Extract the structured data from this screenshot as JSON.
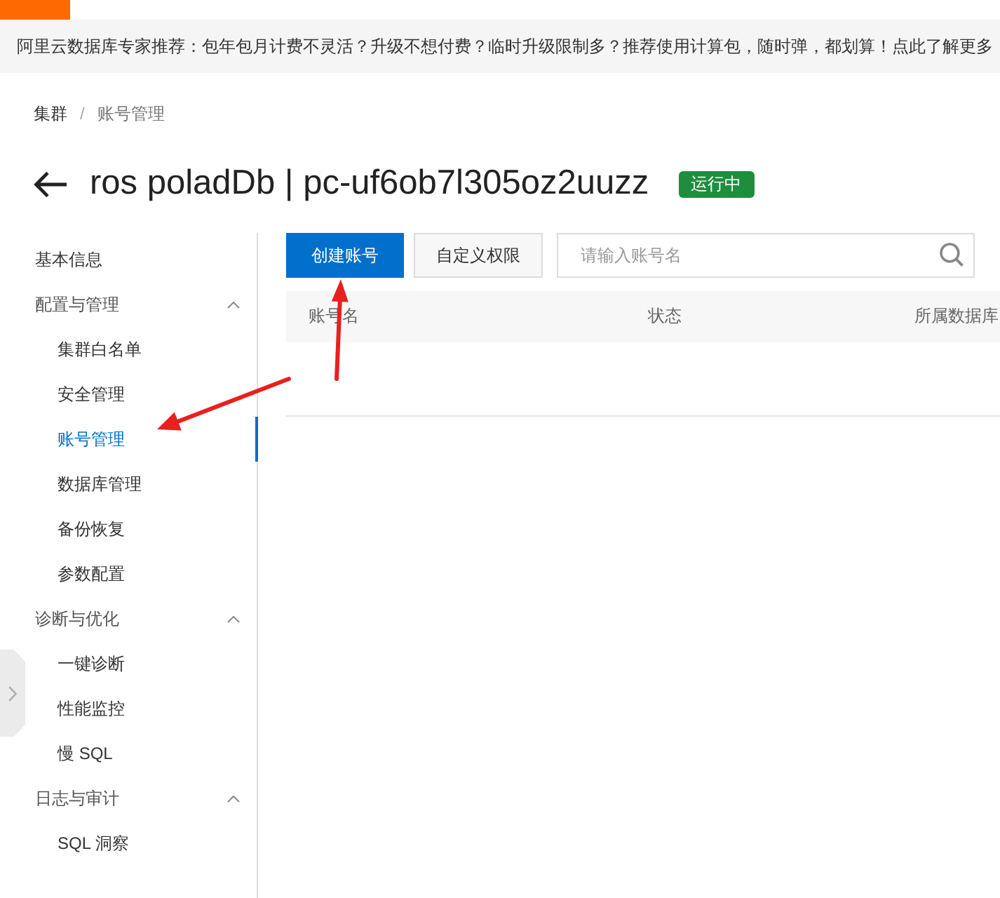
{
  "notice": {
    "text": "阿里云数据库专家推荐：包年包月计费不灵活？升级不想付费？临时升级限制多？推荐使用计算包，随时弹，都划算！点此了解更多"
  },
  "breadcrumb": {
    "separator": "/",
    "items": [
      "集群",
      "账号管理"
    ]
  },
  "header": {
    "title": "ros poladDb | pc-uf6ob7l305oz2uuzz",
    "status": "运行中"
  },
  "sidebar": {
    "items": [
      {
        "kind": "link",
        "label": "基本信息",
        "selected": false
      },
      {
        "kind": "group",
        "label": "配置与管理",
        "selected": false,
        "expanded": true,
        "children": [
          {
            "label": "集群白名单",
            "selected": false
          },
          {
            "label": "安全管理",
            "selected": false
          },
          {
            "label": "账号管理",
            "selected": true
          },
          {
            "label": "数据库管理",
            "selected": false
          },
          {
            "label": "备份恢复",
            "selected": false
          },
          {
            "label": "参数配置",
            "selected": false
          }
        ]
      },
      {
        "kind": "group",
        "label": "诊断与优化",
        "selected": false,
        "expanded": true,
        "children": [
          {
            "label": "一键诊断",
            "selected": false
          },
          {
            "label": "性能监控",
            "selected": false
          },
          {
            "label": "慢 SQL",
            "selected": false
          }
        ]
      },
      {
        "kind": "group",
        "label": "日志与审计",
        "selected": false,
        "expanded": true,
        "children": [
          {
            "label": "SQL 洞察",
            "selected": false
          }
        ]
      }
    ]
  },
  "toolbar": {
    "buttons": [
      {
        "kind": "primary",
        "label": "创建账号"
      },
      {
        "kind": "secondary",
        "label": "自定义权限"
      }
    ],
    "search": {
      "placeholder": "请输入账号名"
    }
  },
  "table": {
    "columns": [
      "账号名",
      "状态",
      "所属数据库"
    ]
  }
}
